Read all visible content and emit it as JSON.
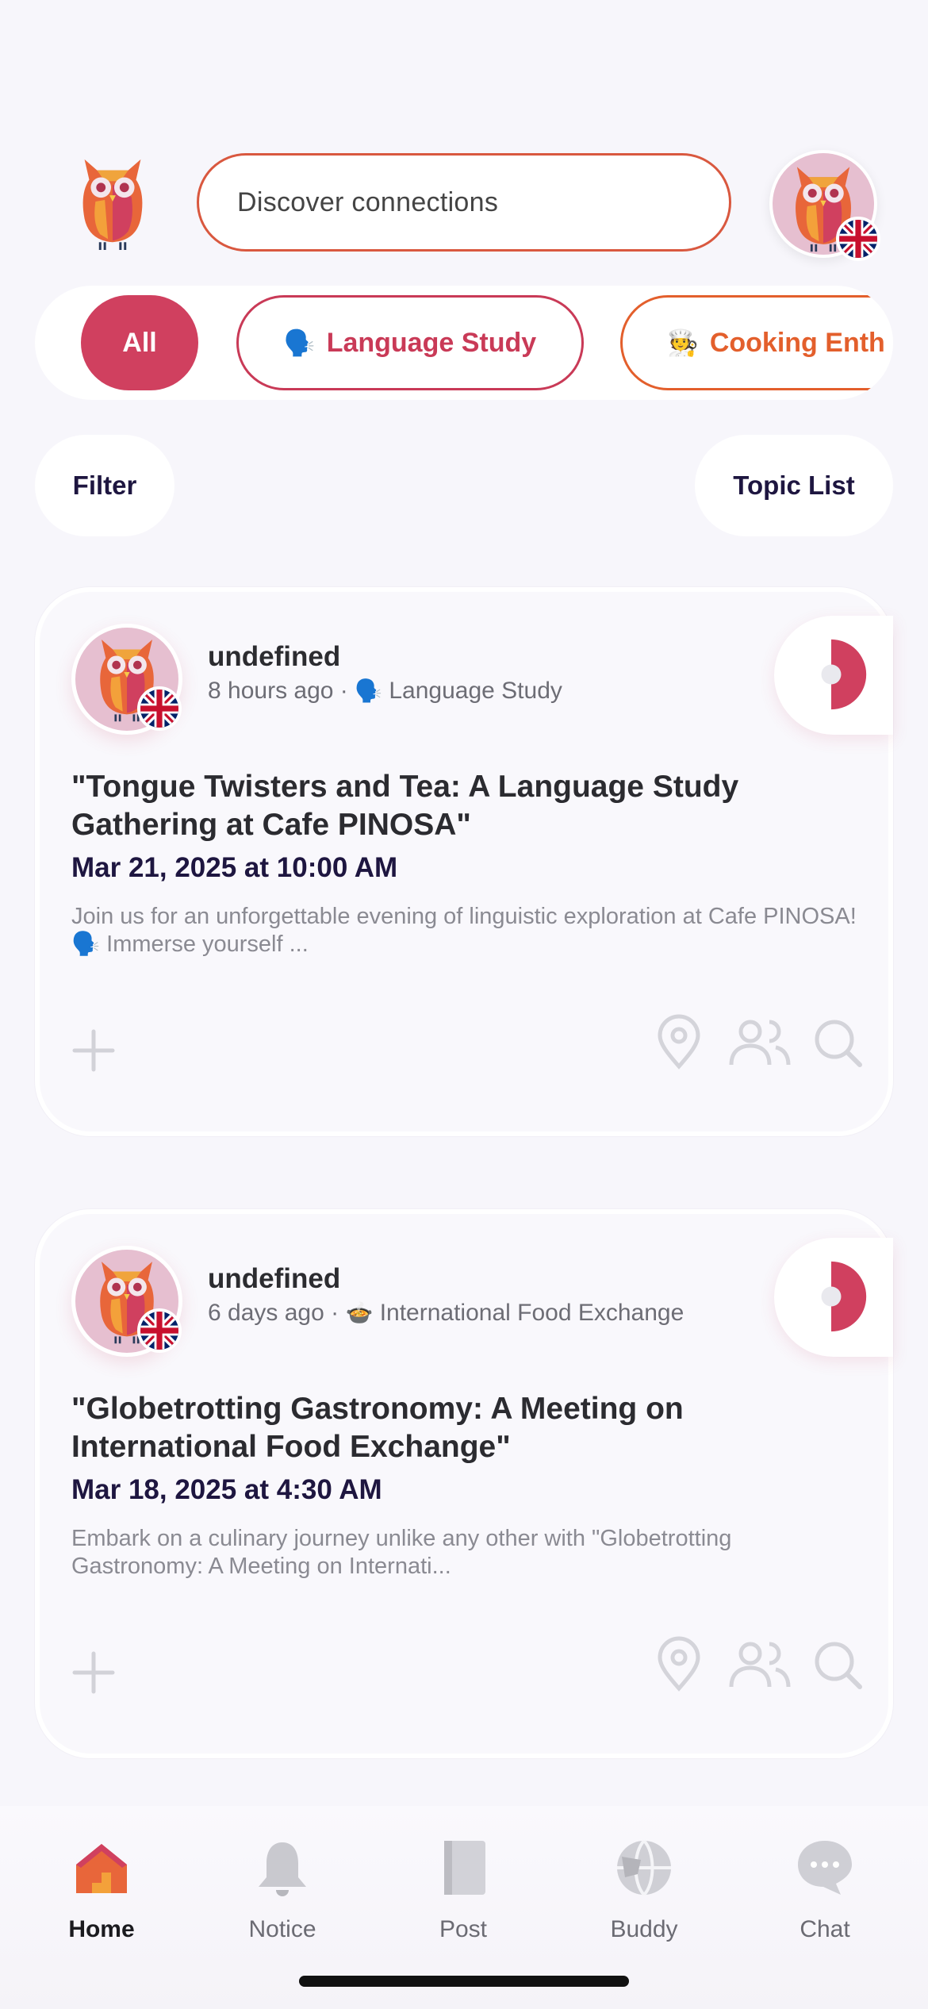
{
  "header": {
    "search_placeholder": "Discover connections"
  },
  "categories": [
    {
      "label": "All",
      "emoji": ""
    },
    {
      "label": "Language Study",
      "emoji": "🗣️"
    },
    {
      "label": "Cooking Enth",
      "emoji": "🧑‍🍳"
    }
  ],
  "controls": {
    "filter_label": "Filter",
    "topic_list_label": "Topic List"
  },
  "posts": [
    {
      "author": "undefined",
      "time_ago": "8 hours ago",
      "separator": "·",
      "topic_emoji": "🗣️",
      "topic": "Language Study",
      "title": "\"Tongue Twisters and Tea: A Language Study Gathering at Cafe PINOSA\"",
      "date": "Mar 21, 2025 at 10:00 AM",
      "description": "Join us for an unforgettable evening of linguistic exploration at Cafe PINOSA! 🗣️ Immerse yourself ..."
    },
    {
      "author": "undefined",
      "time_ago": "6 days ago",
      "separator": "·",
      "topic_emoji": "🍲",
      "topic": "International Food Exchange",
      "title": "\"Globetrotting Gastronomy: A Meeting on International Food Exchange\"",
      "date": "Mar 18, 2025 at 4:30 AM",
      "description": "Embark on a culinary journey unlike any other with \"Globetrotting Gastronomy: A Meeting on Internati..."
    }
  ],
  "tabbar": {
    "tabs": [
      {
        "label": "Home",
        "icon": "home-icon",
        "active": true
      },
      {
        "label": "Notice",
        "icon": "bell-icon",
        "active": false
      },
      {
        "label": "Post",
        "icon": "notebook-icon",
        "active": false
      },
      {
        "label": "Buddy",
        "icon": "globe-icon",
        "active": false
      },
      {
        "label": "Chat",
        "icon": "chat-bubble-icon",
        "active": false
      }
    ]
  },
  "colors": {
    "accent": "#d0405f",
    "orange": "#e35f2c",
    "navy": "#1e1640",
    "background": "#f7f6fb"
  }
}
